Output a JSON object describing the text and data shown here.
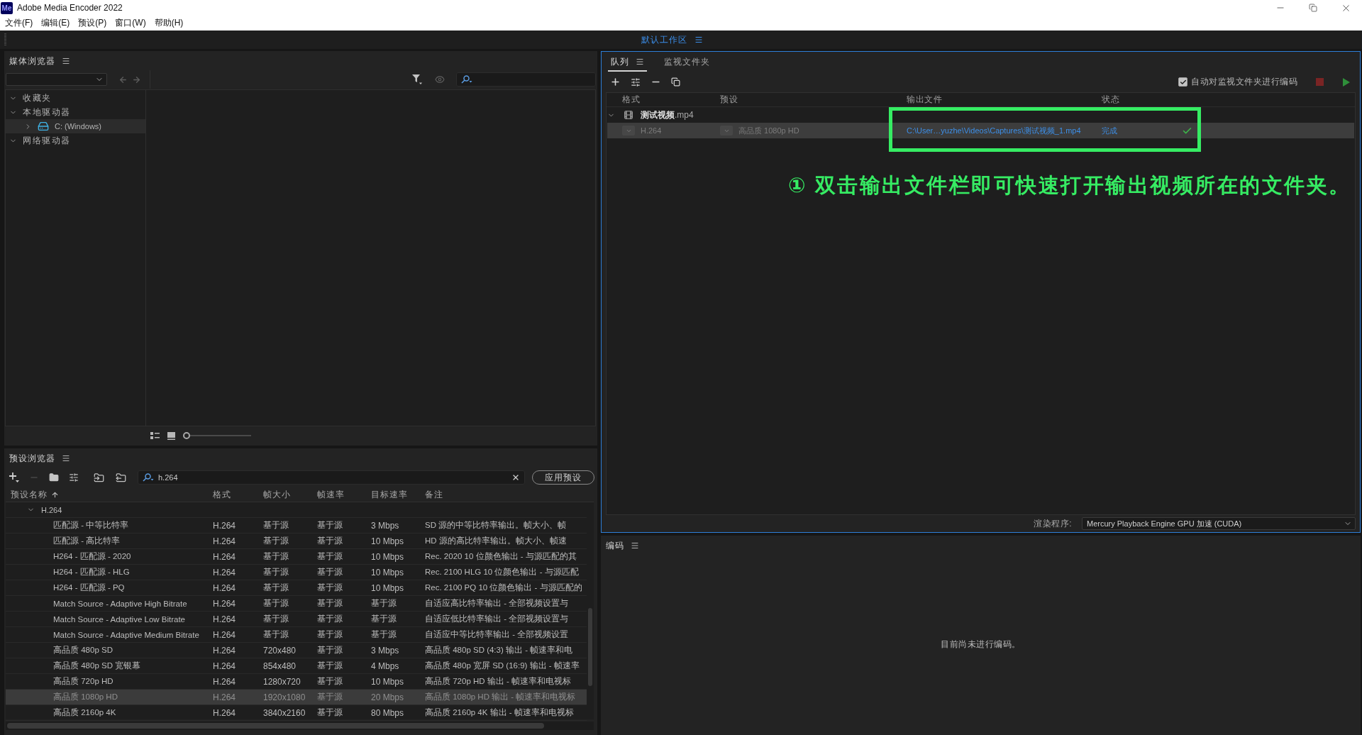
{
  "window": {
    "title": "Adobe Media Encoder 2022",
    "logo": "Me"
  },
  "menu": [
    "文件(F)",
    "编辑(E)",
    "预设(P)",
    "窗口(W)",
    "帮助(H)"
  ],
  "workspace": {
    "label": "默认工作区"
  },
  "media_browser": {
    "title": "媒体浏览器",
    "tree": [
      {
        "label": "收藏夹",
        "kind": "group",
        "expanded": true,
        "selected": false
      },
      {
        "label": "本地驱动器",
        "kind": "group",
        "expanded": true,
        "selected": false,
        "children": [
          {
            "label": "C: (Windows)",
            "kind": "drive",
            "expanded": false,
            "selected": true
          }
        ]
      },
      {
        "label": "网络驱动器",
        "kind": "group",
        "expanded": true,
        "selected": false
      }
    ],
    "zoom_slider": {
      "level": 0
    }
  },
  "preset_browser": {
    "title": "预设浏览器",
    "search": {
      "value": "h.264"
    },
    "apply_button": "应用预设",
    "columns": [
      {
        "label": "预设名称",
        "sorted": true
      },
      {
        "label": "格式",
        "sorted": false
      },
      {
        "label": "帧大小",
        "sorted": false
      },
      {
        "label": "帧速率",
        "sorted": false
      },
      {
        "label": "目标速率",
        "sorted": false
      },
      {
        "label": "备注",
        "sorted": false
      }
    ],
    "groups": [
      {
        "label": "H.264",
        "expanded": true,
        "rows": [
          {
            "name": "匹配源 - 中等比特率",
            "format": "H.264",
            "frame_size": "基于源",
            "frame_rate": "基于源",
            "target_rate": "3 Mbps",
            "notes": "SD 源的中等比特率输出。帧大小、帧",
            "selected": false
          },
          {
            "name": "匹配源 - 高比特率",
            "format": "H.264",
            "frame_size": "基于源",
            "frame_rate": "基于源",
            "target_rate": "10 Mbps",
            "notes": "HD 源的高比特率输出。帧大小、帧速",
            "selected": false
          },
          {
            "name": "H264 - 匹配源 - 2020",
            "format": "H.264",
            "frame_size": "基于源",
            "frame_rate": "基于源",
            "target_rate": "10 Mbps",
            "notes": "Rec. 2020 10 位颜色输出 - 与源匹配的其",
            "selected": false
          },
          {
            "name": "H264 - 匹配源 - HLG",
            "format": "H.264",
            "frame_size": "基于源",
            "frame_rate": "基于源",
            "target_rate": "10 Mbps",
            "notes": "Rec. 2100 HLG 10 位颜色输出 - 与源匹配",
            "selected": false
          },
          {
            "name": "H264 - 匹配源 - PQ",
            "format": "H.264",
            "frame_size": "基于源",
            "frame_rate": "基于源",
            "target_rate": "10 Mbps",
            "notes": "Rec. 2100 PQ 10 位颜色输出 - 与源匹配的",
            "selected": false
          },
          {
            "name": "Match Source - Adaptive High Bitrate",
            "format": "H.264",
            "frame_size": "基于源",
            "frame_rate": "基于源",
            "target_rate": "基于源",
            "notes": "自适应高比特率输出 - 全部视频设置与",
            "selected": false
          },
          {
            "name": "Match Source - Adaptive Low Bitrate",
            "format": "H.264",
            "frame_size": "基于源",
            "frame_rate": "基于源",
            "target_rate": "基于源",
            "notes": "自适应低比特率输出 - 全部视频设置与",
            "selected": false
          },
          {
            "name": "Match Source - Adaptive Medium Bitrate",
            "format": "H.264",
            "frame_size": "基于源",
            "frame_rate": "基于源",
            "target_rate": "基于源",
            "notes": "自适应中等比特率输出 - 全部视频设置",
            "selected": false
          },
          {
            "name": "高品质 480p SD",
            "format": "H.264",
            "frame_size": "720x480",
            "frame_rate": "基于源",
            "target_rate": "3 Mbps",
            "notes": "高品质 480p SD (4:3) 输出 - 帧速率和电",
            "selected": false
          },
          {
            "name": "高品质 480p SD 宽银幕",
            "format": "H.264",
            "frame_size": "854x480",
            "frame_rate": "基于源",
            "target_rate": "4 Mbps",
            "notes": "高品质 480p 宽屏 SD (16:9) 输出 - 帧速率",
            "selected": false
          },
          {
            "name": "高品质 720p HD",
            "format": "H.264",
            "frame_size": "1280x720",
            "frame_rate": "基于源",
            "target_rate": "10 Mbps",
            "notes": "高品质 720p HD 输出 - 帧速率和电视标",
            "selected": false
          },
          {
            "name": "高品质 1080p HD",
            "format": "H.264",
            "frame_size": "1920x1080",
            "frame_rate": "基于源",
            "target_rate": "20 Mbps",
            "notes": "高品质 1080p HD 输出 - 帧速率和电视标",
            "selected": true
          },
          {
            "name": "高品质 2160p 4K",
            "format": "H.264",
            "frame_size": "3840x2160",
            "frame_rate": "基于源",
            "target_rate": "80 Mbps",
            "notes": "高品质 2160p 4K 输出 - 帧速率和电视标",
            "selected": false
          }
        ]
      }
    ]
  },
  "queue_panel": {
    "tabs": [
      {
        "label": "队列",
        "selected": true
      },
      {
        "label": "监视文件夹",
        "selected": false
      }
    ],
    "auto_encode": {
      "label": "自动对监视文件夹进行编码",
      "checked": true
    },
    "columns": [
      "格式",
      "预设",
      "输出文件",
      "状态"
    ],
    "sources": [
      {
        "name": "**测试视频**.mp4",
        "expanded": true,
        "outputs": [
          {
            "format": "H.264",
            "preset": "高品质 1080p HD",
            "output_file": "C:\\User…yuzhe\\Videos\\Captures\\测试视频_1.mp4",
            "status": "完成",
            "done": true,
            "selected": true
          }
        ]
      }
    ],
    "annotation": {
      "text": "① 双击输出文件栏即可快速打开输出视频所在的文件夹。"
    },
    "renderer": {
      "label": "渲染程序:",
      "value": "Mercury Playback Engine GPU 加速 (CUDA)"
    }
  },
  "encoding_panel": {
    "title": "编码",
    "message": "目前尚未进行编码。"
  }
}
